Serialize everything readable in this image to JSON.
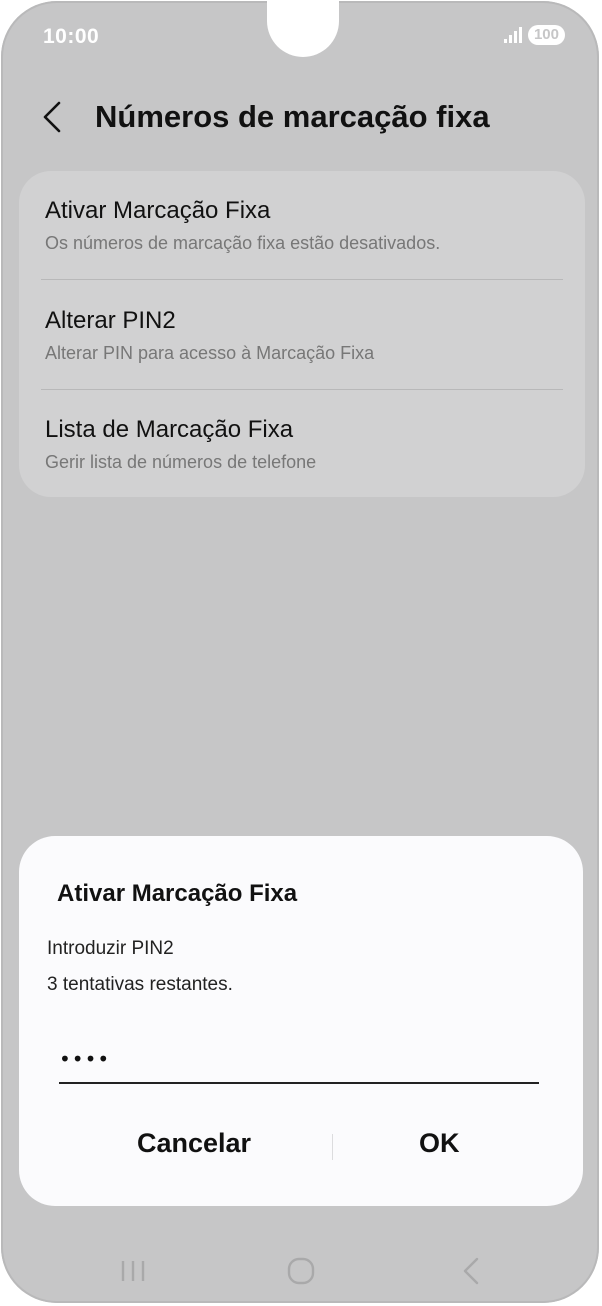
{
  "status_bar": {
    "time": "10:00",
    "battery": "100",
    "signal_icon": "signal-bars-icon"
  },
  "header": {
    "back_icon": "chevron-left-icon",
    "title": "Números de marcação fixa"
  },
  "settings": {
    "items": [
      {
        "title": "Ativar Marcação Fixa",
        "subtitle": "Os números de marcação fixa estão desativados."
      },
      {
        "title": "Alterar PIN2",
        "subtitle": "Alterar PIN para acesso à Marcação Fixa"
      },
      {
        "title": "Lista de Marcação Fixa",
        "subtitle": "Gerir lista de números de telefone"
      }
    ]
  },
  "dialog": {
    "title": "Ativar Marcação Fixa",
    "message_line1": "Introduzir PIN2",
    "message_line2": "3 tentativas restantes.",
    "pin_value": "••••",
    "cancel_label": "Cancelar",
    "ok_label": "OK"
  },
  "nav_bar": {
    "recents_icon": "recents-icon",
    "home_icon": "home-icon",
    "back_icon": "back-icon"
  },
  "colors": {
    "dim_background": "#c6c6c7",
    "card": "#d1d1d2",
    "dialog": "#fbfbfd",
    "text": "#111111",
    "subtext": "#777777"
  }
}
